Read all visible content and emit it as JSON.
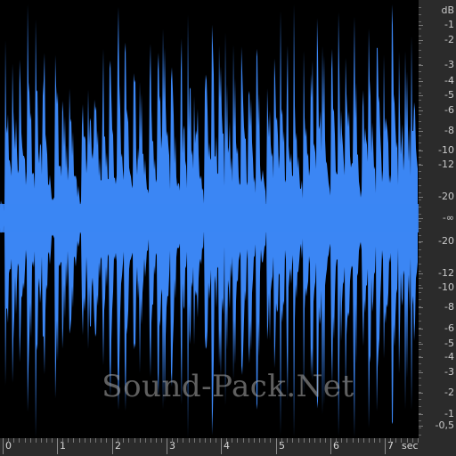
{
  "colors": {
    "wave": "#3b86f4",
    "background": "#000000",
    "ruler": "#2b2b2b"
  },
  "db_ruler": {
    "unit_label": "dB",
    "marks": [
      {
        "label": "-1",
        "db": -1
      },
      {
        "label": "-2",
        "db": -2
      },
      {
        "label": "-3",
        "db": -3
      },
      {
        "label": "-4",
        "db": -4
      },
      {
        "label": "-5",
        "db": -5
      },
      {
        "label": "-6",
        "db": -6
      },
      {
        "label": "-8",
        "db": -8
      },
      {
        "label": "-10",
        "db": -10
      },
      {
        "label": "-12",
        "db": -12
      },
      {
        "label": "-20",
        "db": -20
      },
      {
        "label": "-∞",
        "db": null
      },
      {
        "label": "-20",
        "db": -20
      },
      {
        "label": "-12",
        "db": -12
      },
      {
        "label": "-10",
        "db": -10
      },
      {
        "label": "-8",
        "db": -8
      },
      {
        "label": "-6",
        "db": -6
      },
      {
        "label": "-5",
        "db": -5
      },
      {
        "label": "-4",
        "db": -4
      },
      {
        "label": "-3",
        "db": -3
      },
      {
        "label": "-2",
        "db": -2
      },
      {
        "label": "-1",
        "db": -1
      },
      {
        "label": "-0,5",
        "db": -0.5
      }
    ]
  },
  "time_ruler": {
    "unit_label": "sec",
    "labels": [
      "0",
      "1",
      "2",
      "3",
      "4",
      "5",
      "6",
      "7"
    ]
  },
  "watermark": "Sound-Pack.Net"
}
